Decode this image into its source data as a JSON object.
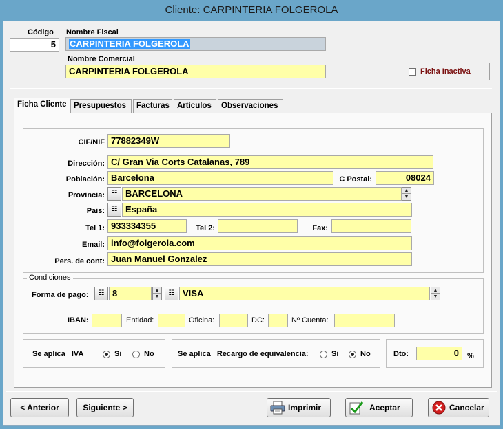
{
  "window": {
    "title": "Cliente: CARPINTERIA FOLGEROLA"
  },
  "header": {
    "codigo_label": "Código",
    "codigo_value": "5",
    "nombre_fiscal_label": "Nombre Fiscal",
    "nombre_fiscal_value": "CARPINTERIA FOLGEROLA",
    "nombre_comercial_label": "Nombre Comercial",
    "nombre_comercial_value": "CARPINTERIA FOLGEROLA",
    "ficha_inactiva_label": "Ficha Inactiva"
  },
  "tabs": [
    "Ficha Cliente",
    "Presupuestos",
    "Facturas",
    "Artículos",
    "Observaciones"
  ],
  "ficha": {
    "cif_label": "CIF/NIF",
    "cif_value": "77882349W",
    "direccion_label": "Dirección:",
    "direccion_value": "C/ Gran Via Corts Catalanas, 789",
    "poblacion_label": "Población:",
    "poblacion_value": "Barcelona",
    "cpostal_label": "C Postal:",
    "cpostal_value": "08024",
    "provincia_label": "Provincia:",
    "provincia_value": "BARCELONA",
    "pais_label": "Pais:",
    "pais_value": "España",
    "tel1_label": "Tel 1:",
    "tel1_value": "933334355",
    "tel2_label": "Tel 2:",
    "tel2_value": "",
    "fax_label": "Fax:",
    "fax_value": "",
    "email_label": "Email:",
    "email_value": "info@folgerola.com",
    "contacto_label": "Pers. de cont:",
    "contacto_value": "Juan Manuel Gonzalez"
  },
  "condiciones": {
    "group_label": "Condiciones",
    "forma_pago_label": "Forma de pago:",
    "forma_pago_code": "8",
    "forma_pago_name": "VISA",
    "iban_label": "IBAN:",
    "entidad_label": "Entidad:",
    "oficina_label": "Oficina:",
    "dc_label": "DC:",
    "ncuenta_label": "Nº Cuenta:"
  },
  "iva": {
    "label": "Se aplica   IVA",
    "si_label": "Si",
    "no_label": "No",
    "selected": "Si"
  },
  "recargo": {
    "label": "Se aplica   Recargo de equivalencia:",
    "si_label": "Si",
    "no_label": "No",
    "selected": "No"
  },
  "dto": {
    "label": "Dto:",
    "value": "0",
    "unit": "%"
  },
  "footer": {
    "anterior": "< Anterior",
    "siguiente": "Siguiente >",
    "imprimir": "Imprimir",
    "aceptar": "Aceptar",
    "cancelar": "Cancelar"
  }
}
